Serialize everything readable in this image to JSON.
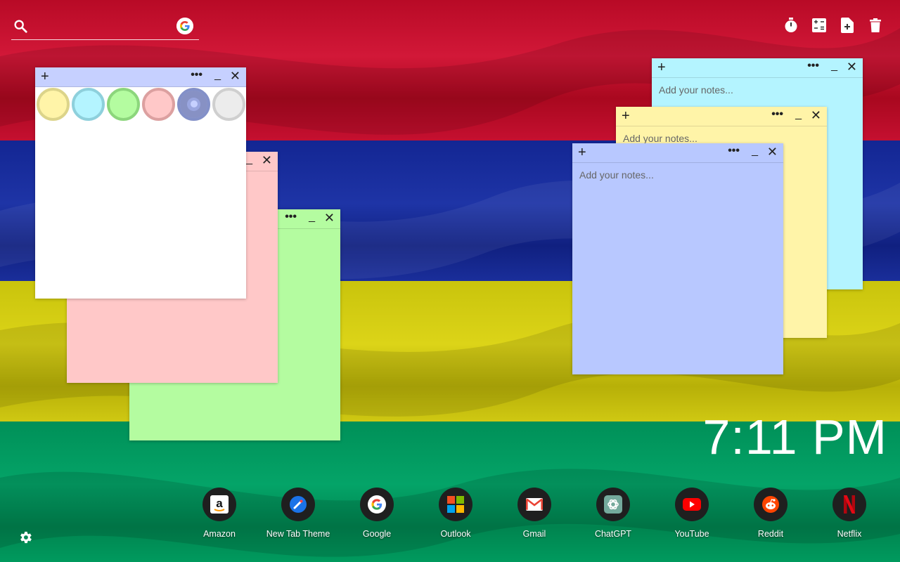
{
  "colors": {
    "flag_red": "#c8102e",
    "flag_blue": "#1a2e9a",
    "flag_yellow": "#d4cc10",
    "flag_green": "#009a5e",
    "note_white": "#ffffff",
    "note_pink": "#ffc8c8",
    "note_green": "#b4fca0",
    "note_cyan": "#b4f4ff",
    "note_yellow": "#fff4a8",
    "note_blue": "#b8c8ff",
    "bar_periwinkle": "#c6d0ff"
  },
  "search": {
    "value": "",
    "placeholder": "",
    "icon": "search-icon",
    "engine_icon": "google-g-icon"
  },
  "tools": [
    {
      "name": "timer-icon"
    },
    {
      "name": "calculator-icon"
    },
    {
      "name": "new-note-icon"
    },
    {
      "name": "trash-icon"
    }
  ],
  "notes": {
    "add_symbol": "+",
    "menu_symbol": "•••",
    "min_symbol": "_",
    "close_symbol": "✕",
    "placeholder": "Add your notes..."
  },
  "swatches": [
    "yellow",
    "cyan",
    "green",
    "pink",
    "blue",
    "white"
  ],
  "clock": {
    "time": "7:11 PM"
  },
  "shortcuts": [
    {
      "label": "Amazon",
      "icon": "amazon-icon"
    },
    {
      "label": "New Tab Theme",
      "icon": "new-tab-theme-icon"
    },
    {
      "label": "Google",
      "icon": "google-icon"
    },
    {
      "label": "Outlook",
      "icon": "outlook-icon"
    },
    {
      "label": "Gmail",
      "icon": "gmail-icon"
    },
    {
      "label": "ChatGPT",
      "icon": "chatgpt-icon"
    },
    {
      "label": "YouTube",
      "icon": "youtube-icon"
    },
    {
      "label": "Reddit",
      "icon": "reddit-icon"
    },
    {
      "label": "Netflix",
      "icon": "netflix-icon"
    }
  ]
}
